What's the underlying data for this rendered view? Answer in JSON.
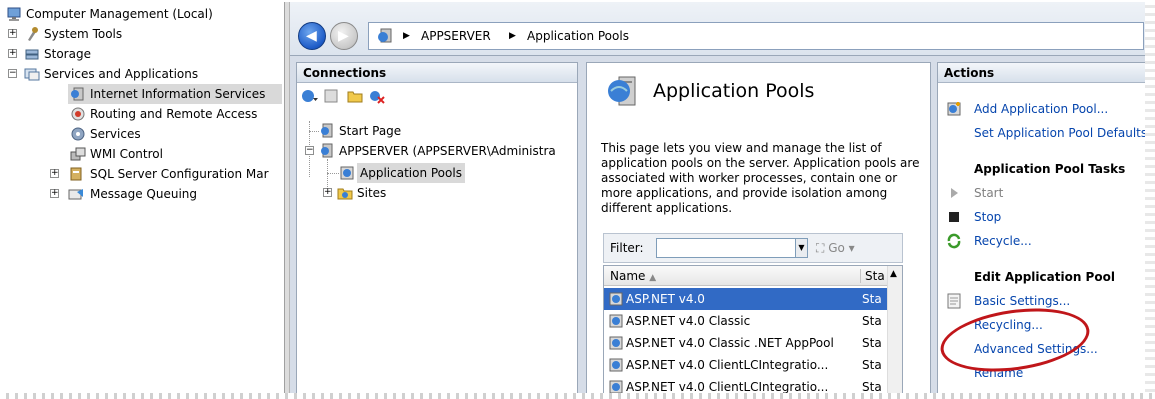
{
  "tree": {
    "items": [
      {
        "label": "Computer Management (Local)"
      },
      {
        "label": "System Tools"
      },
      {
        "label": "Storage"
      },
      {
        "label": "Services and Applications"
      },
      {
        "label": "Internet Information Services"
      },
      {
        "label": "Routing and Remote Access"
      },
      {
        "label": "Services"
      },
      {
        "label": "WMI Control"
      },
      {
        "label": "SQL Server Configuration Mar"
      },
      {
        "label": "Message Queuing"
      }
    ]
  },
  "address": {
    "crumbs": [
      "APPSERVER",
      "Application Pools"
    ],
    "separator": "▶"
  },
  "connections": {
    "title": "Connections",
    "nodes": [
      {
        "label": "Start Page"
      },
      {
        "label": "APPSERVER (APPSERVER\\Administra"
      },
      {
        "label": "Application Pools"
      },
      {
        "label": "Sites"
      }
    ]
  },
  "content": {
    "title": "Application Pools",
    "description": "This page lets you view and manage the list of application pools on the server. Application pools are associated with worker processes, contain one or more applications, and provide isolation among different applications.",
    "filter_label": "Filter:",
    "go_label": "Go",
    "columns": {
      "name": "Name",
      "status": "Sta"
    },
    "rows": [
      {
        "name": "ASP.NET v4.0",
        "status": "Sta"
      },
      {
        "name": "ASP.NET v4.0 Classic",
        "status": "Sta"
      },
      {
        "name": "ASP.NET v4.0 Classic .NET AppPool",
        "status": "Sta"
      },
      {
        "name": "ASP.NET v4.0 ClientLCIntegratio...",
        "status": "Sta"
      },
      {
        "name": "ASP.NET v4.0 ClientLCIntegratio...",
        "status": "Sta"
      }
    ]
  },
  "actions": {
    "title": "Actions",
    "add_pool": "Add Application Pool...",
    "set_defaults": "Set Application Pool Defaults",
    "tasks_heading": "Application Pool Tasks",
    "start": "Start",
    "stop": "Stop",
    "recycle": "Recycle...",
    "edit_heading": "Edit Application Pool",
    "basic": "Basic Settings...",
    "recycling": "Recycling...",
    "advanced": "Advanced Settings...",
    "rename": "Rename"
  },
  "colors": {
    "selection": "#316ac5",
    "link": "#0645ad",
    "highlight_circle": "#c0161a"
  }
}
